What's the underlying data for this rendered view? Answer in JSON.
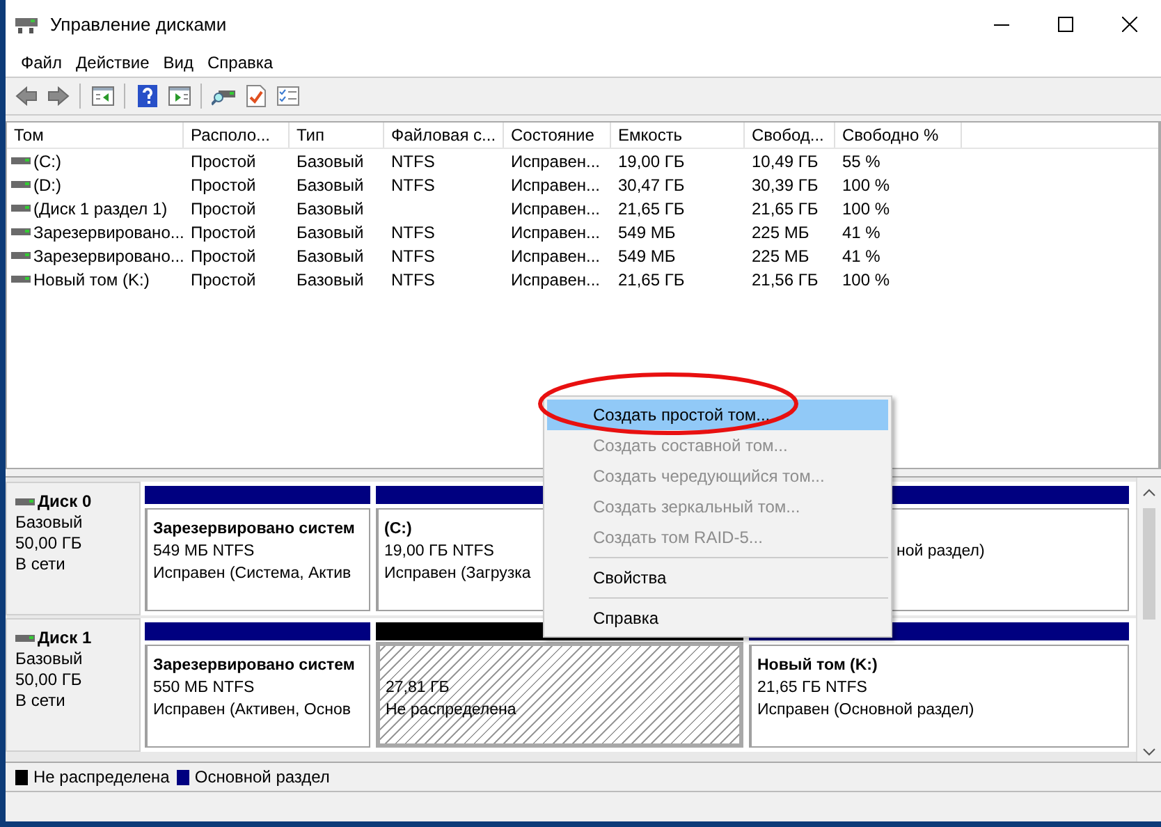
{
  "window": {
    "title": "Управление дисками"
  },
  "menu": [
    "Файл",
    "Действие",
    "Вид",
    "Справка"
  ],
  "table": {
    "columns": [
      "Том",
      "Располо...",
      "Тип",
      "Файловая с...",
      "Состояние",
      "Емкость",
      "Свобод...",
      "Свободно %"
    ],
    "rows": [
      {
        "cells": [
          "(C:)",
          "Простой",
          "Базовый",
          "NTFS",
          "Исправен...",
          "19,00 ГБ",
          "10,49 ГБ",
          "55 %"
        ]
      },
      {
        "cells": [
          "(D:)",
          "Простой",
          "Базовый",
          "NTFS",
          "Исправен...",
          "30,47 ГБ",
          "30,39 ГБ",
          "100 %"
        ]
      },
      {
        "cells": [
          "(Диск 1 раздел 1)",
          "Простой",
          "Базовый",
          "",
          "Исправен...",
          "21,65 ГБ",
          "21,65 ГБ",
          "100 %"
        ]
      },
      {
        "cells": [
          "Зарезервировано...",
          "Простой",
          "Базовый",
          "NTFS",
          "Исправен...",
          "549 МБ",
          "225 МБ",
          "41 %"
        ]
      },
      {
        "cells": [
          "Зарезервировано...",
          "Простой",
          "Базовый",
          "NTFS",
          "Исправен...",
          "549 МБ",
          "225 МБ",
          "41 %"
        ]
      },
      {
        "cells": [
          "Новый том (K:)",
          "Простой",
          "Базовый",
          "NTFS",
          "Исправен...",
          "21,65 ГБ",
          "21,56 ГБ",
          "100 %"
        ]
      }
    ]
  },
  "disks": [
    {
      "name": "Диск 0",
      "type": "Базовый",
      "size": "50,00 ГБ",
      "status": "В сети",
      "partitions": [
        {
          "kind": "primary",
          "selected": false,
          "covered": false,
          "name": "Зарезервировано систем",
          "size": "549 МБ NTFS",
          "status": "Исправен (Система, Актив"
        },
        {
          "kind": "primary",
          "selected": false,
          "covered": false,
          "name": "(C:)",
          "size": "19,00 ГБ NTFS",
          "status": "Исправен (Загрузка"
        },
        {
          "kind": "primary",
          "selected": false,
          "covered": true,
          "status": "ной раздел)"
        }
      ]
    },
    {
      "name": "Диск 1",
      "type": "Базовый",
      "size": "50,00 ГБ",
      "status": "В сети",
      "partitions": [
        {
          "kind": "primary",
          "selected": false,
          "covered": false,
          "name": "Зарезервировано систем",
          "size": "550 МБ NTFS",
          "status": "Исправен (Активен, Основ"
        },
        {
          "kind": "unallocated",
          "selected": true,
          "covered": false,
          "size": "27,81 ГБ",
          "status": "Не распределена"
        },
        {
          "kind": "primary",
          "selected": false,
          "covered": false,
          "name": "Новый том  (K:)",
          "size": "21,65 ГБ NTFS",
          "status": "Исправен (Основной раздел)"
        }
      ]
    }
  ],
  "legend": [
    {
      "label": "Не распределена",
      "color": "#000000"
    },
    {
      "label": "Основной раздел",
      "color": "#000080"
    }
  ],
  "context_menu": {
    "items": [
      {
        "kind": "item",
        "label": "Создать простой том...",
        "disabled": false,
        "selected": true
      },
      {
        "kind": "item",
        "label": "Создать составной том...",
        "disabled": true,
        "selected": false
      },
      {
        "kind": "item",
        "label": "Создать чередующийся том...",
        "disabled": true,
        "selected": false
      },
      {
        "kind": "item",
        "label": "Создать зеркальный том...",
        "disabled": true,
        "selected": false
      },
      {
        "kind": "item",
        "label": "Создать том RAID-5...",
        "disabled": true,
        "selected": false
      },
      {
        "kind": "separator"
      },
      {
        "kind": "item",
        "label": "Свойства",
        "disabled": false,
        "selected": false
      },
      {
        "kind": "separator"
      },
      {
        "kind": "item",
        "label": "Справка",
        "disabled": false,
        "selected": false
      }
    ]
  }
}
